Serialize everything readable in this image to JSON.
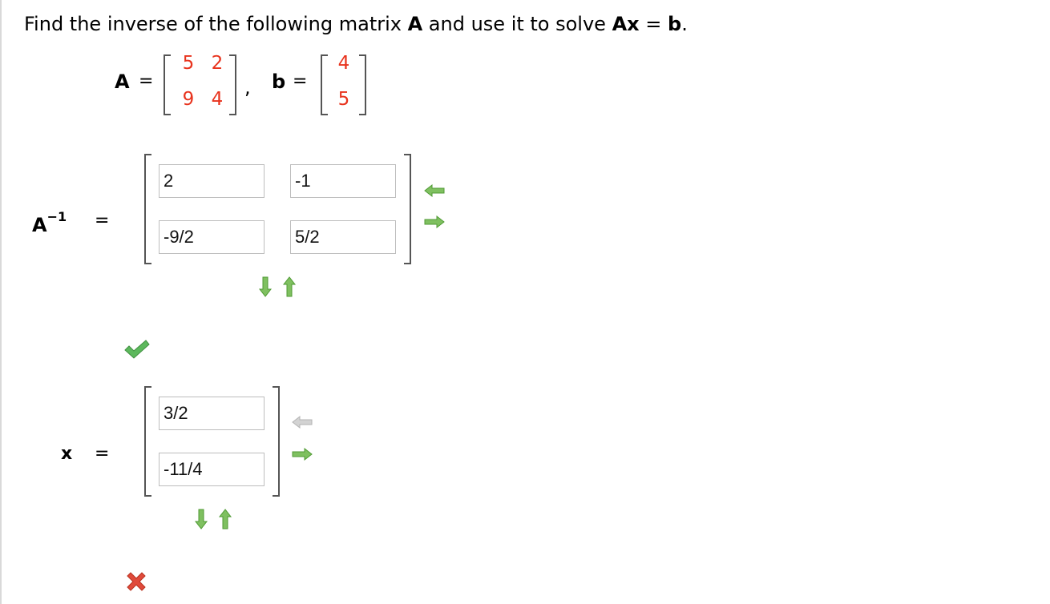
{
  "prompt": {
    "text_1": "Find the inverse of the following matrix ",
    "bold_A": "A",
    "text_2": " and use it to solve  ",
    "bold_Ax": "Ax",
    "text_3": " = ",
    "bold_b": "b",
    "text_4": "."
  },
  "given": {
    "a_label": "A",
    "b_label": "b",
    "equals": "=",
    "comma": ",",
    "matrix_a": [
      [
        "5",
        "2"
      ],
      [
        "9",
        "4"
      ]
    ],
    "vector_b": [
      "4",
      "5"
    ],
    "entry_color": "#e8331d"
  },
  "inverse": {
    "label_base": "A",
    "label_exp": "−1",
    "equals": "=",
    "cells": [
      [
        "2",
        "-1"
      ],
      [
        "-9/2",
        "5/2"
      ]
    ],
    "status": "correct"
  },
  "solution": {
    "label": "x",
    "equals": "=",
    "cells": [
      "3/2",
      "-11/4"
    ],
    "status": "incorrect"
  },
  "colors": {
    "arrow_active": "#6cb44c",
    "arrow_inactive": "#c9c9c9",
    "check": "#5cb85c",
    "cross": "#e04a3b"
  }
}
